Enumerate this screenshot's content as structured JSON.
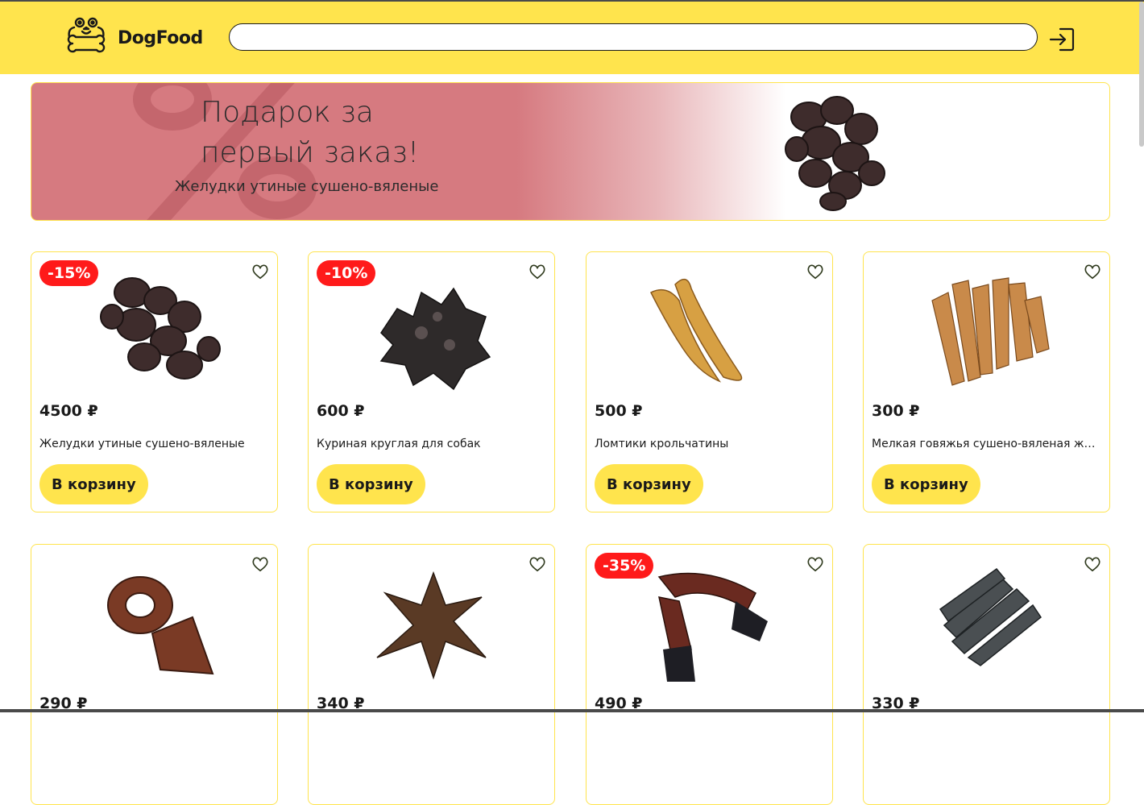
{
  "header": {
    "logo_text": "DogFood",
    "search_placeholder": "",
    "colors": {
      "accent": "#ffe44d",
      "discount": "#ff1a1a",
      "text": "#1a1a1a"
    }
  },
  "banner": {
    "title": "Подарок за первый заказ!",
    "subtitle": "Желудки утиные сушено-вяленые"
  },
  "products": [
    {
      "discount": "-15%",
      "price": "4500 ₽",
      "name": "Желудки утиные сушено-вяленые",
      "button": "В корзину"
    },
    {
      "discount": "-10%",
      "price": "600 ₽",
      "name": "Куриная круглая для собак",
      "button": "В корзину"
    },
    {
      "discount": "",
      "price": "500 ₽",
      "name": "Ломтики крольчатины",
      "button": "В корзину"
    },
    {
      "discount": "",
      "price": "300 ₽",
      "name": "Мелкая говяжья сушено-вяленая жил...",
      "button": "В корзину"
    },
    {
      "discount": "",
      "price": "290 ₽",
      "name": "",
      "button": ""
    },
    {
      "discount": "",
      "price": "340 ₽",
      "name": "",
      "button": ""
    },
    {
      "discount": "-35%",
      "price": "490 ₽",
      "name": "",
      "button": ""
    },
    {
      "discount": "",
      "price": "330 ₽",
      "name": "",
      "button": ""
    }
  ]
}
